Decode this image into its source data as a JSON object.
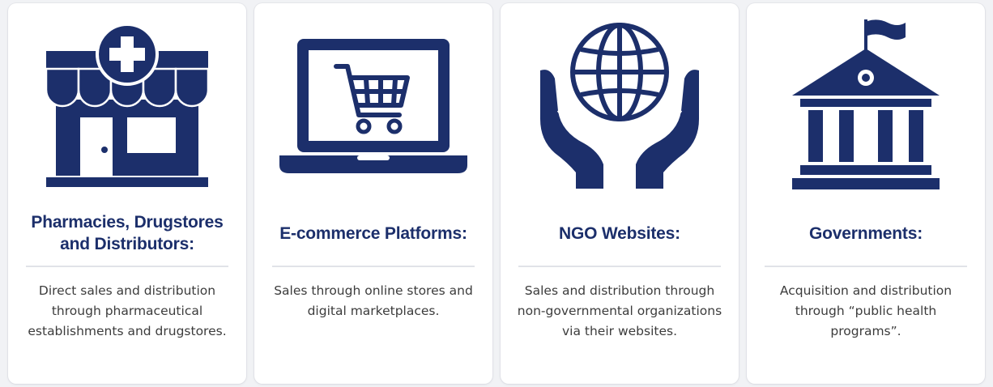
{
  "cards": [
    {
      "icon": "pharmacy-store-icon",
      "title": "Pharmacies, Drugstores and Distributors:",
      "description": "Direct sales and distribution through pharmaceutical establishments and drugstores."
    },
    {
      "icon": "laptop-cart-icon",
      "title": "E-commerce Platforms:",
      "description": "Sales through online stores and digital marketplaces."
    },
    {
      "icon": "hands-globe-icon",
      "title": "NGO Websites:",
      "description": "Sales and distribution through non-governmental organizations via their websites."
    },
    {
      "icon": "government-building-icon",
      "title": "Governments:",
      "description": "Acquisition and distribution through “public health programs”."
    }
  ],
  "colors": {
    "navy": "#1c2f6b",
    "card_background": "#ffffff",
    "page_background": "#f1f2f5",
    "description_text": "#3c3c3c",
    "divider": "#e1e3e8"
  }
}
